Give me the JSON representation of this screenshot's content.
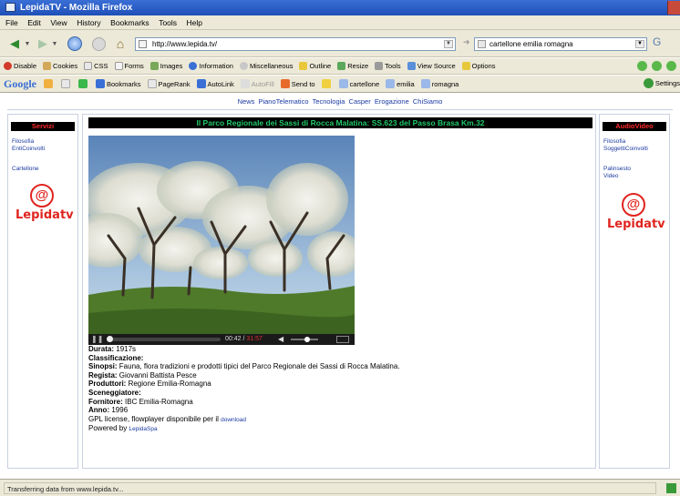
{
  "window": {
    "title": "LepidaTV - Mozilla Firefox"
  },
  "menu": [
    "File",
    "Edit",
    "View",
    "History",
    "Bookmarks",
    "Tools",
    "Help"
  ],
  "nav": {
    "url": "http://www.lepida.tv/",
    "search_value": "cartellone emilia romagna"
  },
  "devtoolbar": {
    "items": [
      "Disable",
      "Cookies",
      "CSS",
      "Forms",
      "Images",
      "Information",
      "Miscellaneous",
      "Outline",
      "Resize",
      "Tools",
      "View Source",
      "Options"
    ]
  },
  "googlebar": {
    "logo": "Google",
    "items": [
      "Bookmarks",
      "PageRank",
      "AutoLink",
      "AutoFill",
      "Send to",
      "cartellone",
      "emilia",
      "romagna"
    ],
    "settings": "Settings"
  },
  "page": {
    "topnav": [
      "News",
      "PianoTelematico",
      "Tecnologia",
      "Casper",
      "Erogazione",
      "ChiSiamo"
    ],
    "left": {
      "heading": "Servizi",
      "links": [
        "Filosofia",
        "EntiCoinvolti",
        "Cartellone"
      ],
      "logo_text": "Lepidatv"
    },
    "right": {
      "heading": "AudioVideo",
      "links": [
        "Filosofia",
        "SoggettiCoinvolti",
        "Palinsesto",
        "Video"
      ],
      "logo_text": "Lepidatv"
    },
    "main": {
      "title": "Il Parco Regionale dei Sassi di Rocca Malatina: SS.623 del Passo Brasa Km.32",
      "player": {
        "time": "00:42",
        "duration": "31:57",
        "progress": 0.02,
        "volume": 0.6
      },
      "meta": {
        "durata_label": "Durata:",
        "durata": "1917s",
        "classificazione_label": "Classificazione:",
        "sinopsi_label": "Sinopsi:",
        "sinopsi": "Fauna, flora tradizioni e prodotti tipici del Parco Regionale dei Sassi di Rocca Malatina.",
        "regista_label": "Regista:",
        "regista": "Giovanni Battista Pesce",
        "produttori_label": "Produttori:",
        "produttori": "Regione Emilia-Romagna",
        "sceneggiatore_label": "Sceneggiatore:",
        "fornitore_label": "Fornitore:",
        "fornitore": "IBC Emilia-Romagna",
        "anno_label": "Anno:",
        "anno": "1996",
        "license_text": "GPL license, flowplayer disponibile per il",
        "download_link": "download",
        "powered_text": "Powered by",
        "powered_link": "LepidaSpa"
      }
    }
  },
  "status": {
    "text": "Transferring data from www.lepida.tv..."
  },
  "colors": {
    "heading_red": "#ff2a2a",
    "title_green": "#22c86a",
    "link_blue": "#1a3aa0",
    "logo_red": "#e0241e"
  }
}
